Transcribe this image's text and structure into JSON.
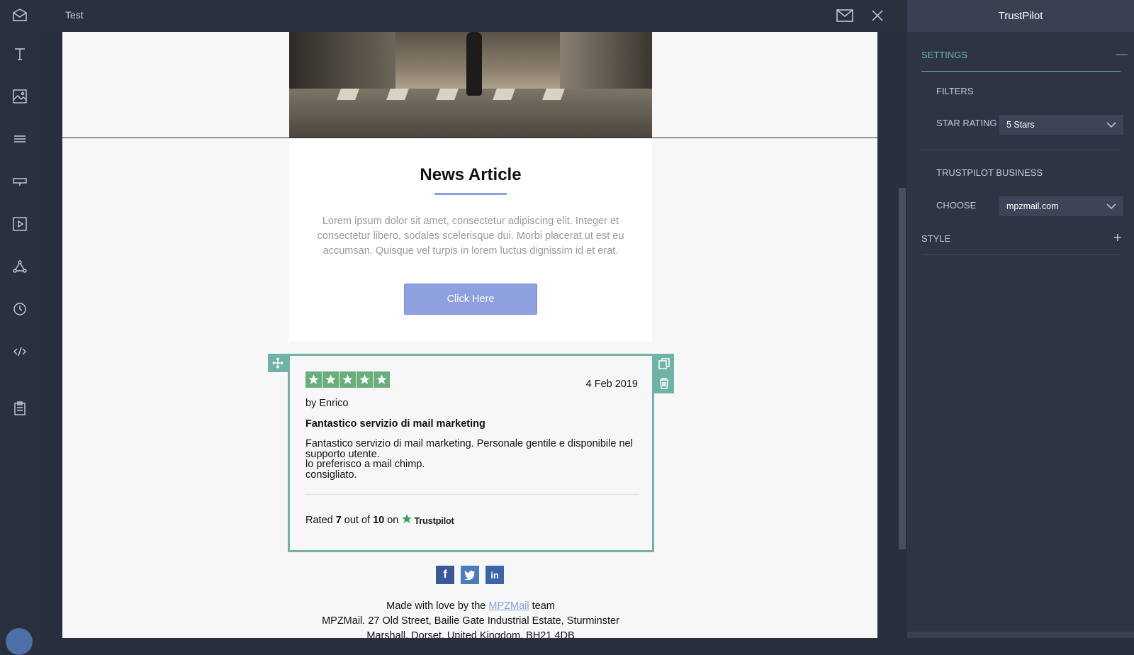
{
  "topbar": {
    "title": "Test"
  },
  "rail": {
    "items": [
      "envelope-icon",
      "text-icon",
      "image-icon",
      "divider-icon",
      "button-icon",
      "video-icon",
      "social-icon",
      "timer-icon",
      "code-icon",
      "clipboard-icon"
    ]
  },
  "article": {
    "title": "News Article",
    "body": "Lorem ipsum dolor sit amet, consectetur adipiscing elit. Integer et consectetur libero, sodales scelerisque dui. Morbi placerat ut est eu accumsan. Quisque vel turpis in lorem luctus dignissim id et erat.",
    "cta_label": "Click Here"
  },
  "review": {
    "stars": 5,
    "date": "4 Feb 2019",
    "author": "by Enrico",
    "title": "Fantastico servizio di mail marketing",
    "body_lines": [
      "Fantastico servizio di mail marketing. Personale gentile e disponibile nel",
      "supporto utente.",
      "lo preferisco a mail chimp.",
      "consigliato."
    ],
    "rated_prefix": "Rated",
    "rated_score": "7",
    "rated_mid": "out of",
    "rated_max": "10",
    "rated_on": "on",
    "brand": "Trustpilot",
    "star_color": "#6aaf7b"
  },
  "footer": {
    "line1_prefix": "Made with love by the",
    "line1_link": "MPZMail",
    "line1_suffix": "team",
    "line2": "MPZMail. 27 Old Street, Bailie Gate Industrial Estate, Sturminster",
    "line3": "Marshall, Dorset, United Kingdom, BH21 4DB"
  },
  "panel": {
    "title": "TrustPilot",
    "settings_label": "SETTINGS",
    "settings_toggle": "—",
    "filters_label": "FILTERS",
    "star_rating_label": "STAR RATING",
    "star_rating_value": "5 Stars",
    "business_label": "TRUSTPILOT BUSINESS",
    "choose_label": "CHOOSE",
    "choose_value": "mpzmail.com",
    "style_label": "STYLE",
    "style_toggle": "+"
  },
  "colors": {
    "accent": "#6fb3a6",
    "button": "#8ea0e0",
    "panel": "#2f3444"
  }
}
